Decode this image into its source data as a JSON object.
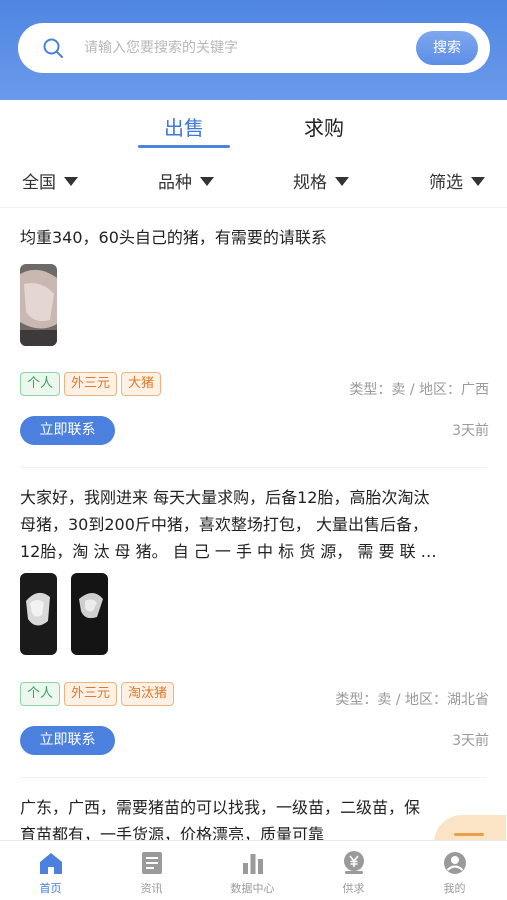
{
  "search": {
    "placeholder": "请输入您要搜索的关键字",
    "button_label": "搜索"
  },
  "tabs": [
    {
      "label": "出售",
      "active": true
    },
    {
      "label": "求购",
      "active": false
    }
  ],
  "filters": [
    {
      "label": "全国"
    },
    {
      "label": "品种"
    },
    {
      "label": "规格"
    },
    {
      "label": "筛选"
    }
  ],
  "listings": [
    {
      "text": "均重340，60头自己的猪，有需要的请联系",
      "tags": [
        "个人",
        "外三元",
        "大猪"
      ],
      "meta": "类型：卖 / 地区：广西",
      "contact_label": "立即联系",
      "time": "3天前"
    },
    {
      "text_lines": [
        "大家好，我刚进来 每天大量求购，后备12胎，高胎次淘汰",
        "母猪，30到200斤中猪，喜欢整场打包， 大量出售后备，",
        "12胎，淘 汰 母 猪。 自 己 一 手 中 标 货 源，  需 要 联 …"
      ],
      "tags": [
        "个人",
        "外三元",
        "淘汰猪"
      ],
      "meta": "类型：卖 / 地区：湖北省",
      "contact_label": "立即联系",
      "time": "3天前"
    },
    {
      "text_lines": [
        "广东，广西，需要猪苗的可以找我，一级苗，二级苗，保",
        "育苗都有，一手货源，价格漂亮，质量可靠"
      ]
    }
  ],
  "bottom_nav": [
    {
      "label": "首页",
      "icon": "home-icon",
      "active": true
    },
    {
      "label": "资讯",
      "icon": "news-icon",
      "active": false
    },
    {
      "label": "数据中心",
      "icon": "chart-icon",
      "active": false
    },
    {
      "label": "供求",
      "icon": "yuan-icon",
      "active": false
    },
    {
      "label": "我的",
      "icon": "user-icon",
      "active": false
    }
  ],
  "colors": {
    "accent": "#4b80de",
    "tag_green": "#37a35a",
    "tag_orange": "#e07a2c",
    "muted": "#9a9a9a"
  }
}
